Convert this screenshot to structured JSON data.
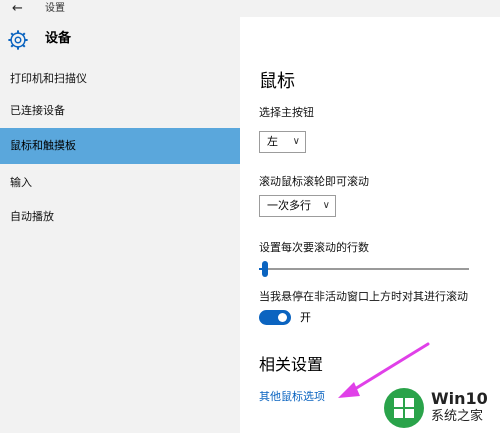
{
  "titlebar": {
    "back_icon": "back-arrow-icon",
    "title": "设置"
  },
  "header": {
    "icon": "gear-icon",
    "title": "设备"
  },
  "sidebar": {
    "items": [
      {
        "label": "打印机和扫描仪"
      },
      {
        "label": "已连接设备"
      },
      {
        "label": "鼠标和触摸板",
        "active": true
      },
      {
        "label": "输入"
      },
      {
        "label": "自动播放"
      }
    ]
  },
  "main": {
    "heading": "鼠标",
    "primary_button": {
      "label": "选择主按钮",
      "value": "左"
    },
    "wheel": {
      "label": "滚动鼠标滚轮即可滚动",
      "value": "一次多行"
    },
    "lines": {
      "label": "设置每次要滚动的行数",
      "value_fraction": 0.03
    },
    "inactive_scroll": {
      "label": "当我悬停在非活动窗口上方时对其进行滚动",
      "state": "开",
      "on": true
    },
    "related_heading": "相关设置",
    "other_options_link": "其他鼠标选项"
  },
  "colors": {
    "accent": "#0b64c0",
    "sidebar_active": "#5aa7dc",
    "annotation_arrow": "#e040e8"
  },
  "watermark": {
    "line1": "Win10",
    "line2": "系统之家"
  }
}
